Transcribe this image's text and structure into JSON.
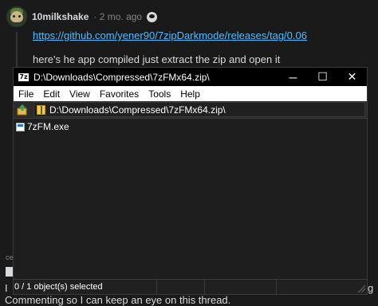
{
  "comment": {
    "username": "10milkshake",
    "time": "· 2 mo. ago",
    "link": "https://github.com/yener90/7zipDarkmode/releases/tag/0.06",
    "text": "here's he app compiled just extract the zip and open it"
  },
  "background_fragments": {
    "label": "ce",
    "line_start": "I",
    "line2": "Commenting so I can keep an eye on this thread.",
    "right_fragment": "g"
  },
  "window": {
    "app_icon_text": "7z",
    "title": "D:\\Downloads\\Compressed\\7zFMx64.zip\\",
    "controls": {
      "minimize": "─",
      "maximize": "☐",
      "close": "✕"
    },
    "menu": [
      "File",
      "Edit",
      "View",
      "Favorites",
      "Tools",
      "Help"
    ],
    "address": "D:\\Downloads\\Compressed\\7zFMx64.zip\\",
    "files": [
      {
        "name": "7zFM.exe"
      }
    ],
    "status": "0 / 1 object(s) selected"
  },
  "colors": {
    "page_bg": "#1a1a1b",
    "link": "#4fbcff",
    "window_bg": "#202020",
    "titlebar": "#000000",
    "menubar": "#ffffff"
  }
}
